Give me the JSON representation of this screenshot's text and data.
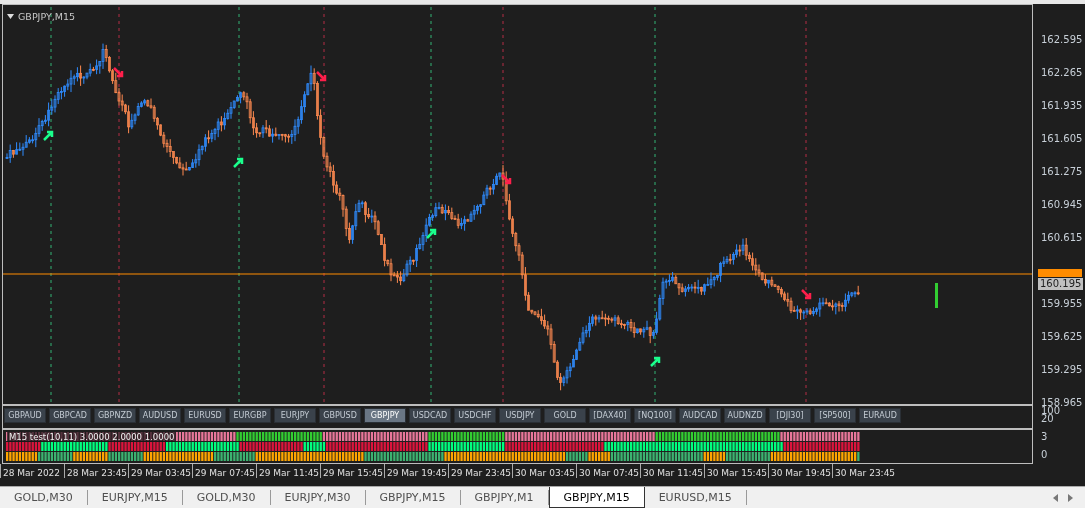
{
  "chart": {
    "title": "GBPJPY,M15",
    "price_axis": [
      "162.595",
      "162.265",
      "161.935",
      "161.605",
      "161.275",
      "160.945",
      "160.615",
      "159.955",
      "159.625",
      "159.295",
      "158.965"
    ],
    "current_price": "160.195"
  },
  "symbol_buttons": [
    {
      "label": "GBPAUD",
      "selected": false
    },
    {
      "label": "GBPCAD",
      "selected": false
    },
    {
      "label": "GBPNZD",
      "selected": false
    },
    {
      "label": "AUDUSD",
      "selected": false
    },
    {
      "label": "EURUSD",
      "selected": false
    },
    {
      "label": "EURGBP",
      "selected": false
    },
    {
      "label": "EURJPY",
      "selected": false
    },
    {
      "label": "GBPUSD",
      "selected": false
    },
    {
      "label": "GBPJPY",
      "selected": true
    },
    {
      "label": "USDCAD",
      "selected": false
    },
    {
      "label": "USDCHF",
      "selected": false
    },
    {
      "label": "USDJPY",
      "selected": false
    },
    {
      "label": "GOLD",
      "selected": false
    },
    {
      "label": "[DAX40]",
      "selected": false
    },
    {
      "label": "[NQ100]",
      "selected": false
    },
    {
      "label": "AUDCAD",
      "selected": false
    },
    {
      "label": "AUDNZD",
      "selected": false
    },
    {
      "label": "[DJI30]",
      "selected": false
    },
    {
      "label": "[SP500]",
      "selected": false
    },
    {
      "label": "EURAUD",
      "selected": false
    }
  ],
  "button_panel_axis": [
    "100",
    "20"
  ],
  "indicator": {
    "label": "M15 test(10,11) 3.0000 2.0000 1.0000",
    "axis": [
      "3",
      "0"
    ]
  },
  "time_axis": [
    "28 Mar 2022",
    "28 Mar 23:45",
    "29 Mar 03:45",
    "29 Mar 07:45",
    "29 Mar 11:45",
    "29 Mar 15:45",
    "29 Mar 19:45",
    "29 Mar 23:45",
    "30 Mar 03:45",
    "30 Mar 07:45",
    "30 Mar 11:45",
    "30 Mar 15:45",
    "30 Mar 19:45",
    "30 Mar 23:45"
  ],
  "tabs": [
    {
      "label": "GOLD,M30",
      "selected": false
    },
    {
      "label": "EURJPY,M15",
      "selected": false
    },
    {
      "label": "GOLD,M30",
      "selected": false
    },
    {
      "label": "EURJPY,M30",
      "selected": false
    },
    {
      "label": "GBPJPY,M15",
      "selected": false
    },
    {
      "label": "GBPJPY,M1",
      "selected": false
    },
    {
      "label": "GBPJPY,M15",
      "selected": true
    },
    {
      "label": "EURUSD,M15",
      "selected": false
    }
  ]
}
